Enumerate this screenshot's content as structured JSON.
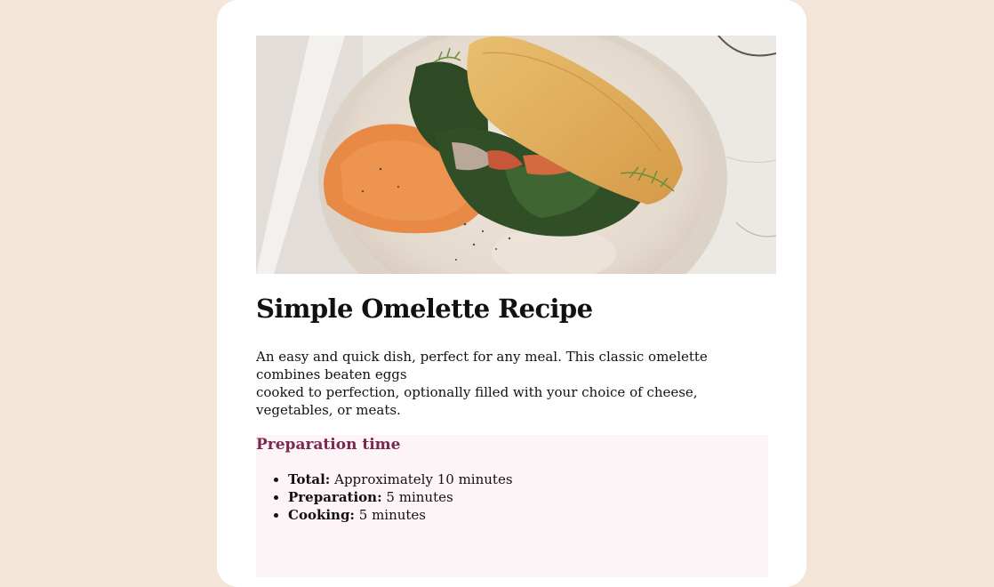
{
  "recipe": {
    "image": {
      "alt": "Omelette with spinach, dill and hummus on a plate"
    },
    "title": "Simple Omelette Recipe",
    "intro_line1": "An easy and quick dish, perfect for any meal. This classic omelette combines beaten eggs",
    "intro_line2": "cooked to perfection, optionally filled with your choice of cheese, vegetables, or meats.",
    "preparation": {
      "heading": "Preparation time",
      "items": [
        {
          "label": "Total:",
          "value": " Approximately 10 minutes"
        },
        {
          "label": "Preparation:",
          "value": " 5 minutes"
        },
        {
          "label": "Cooking:",
          "value": " 5 minutes"
        }
      ]
    }
  },
  "colors": {
    "page_background": "#f3e5d8",
    "card_background": "#ffffff",
    "prep_background": "#fdf4f8",
    "prep_heading": "#7a284e"
  }
}
